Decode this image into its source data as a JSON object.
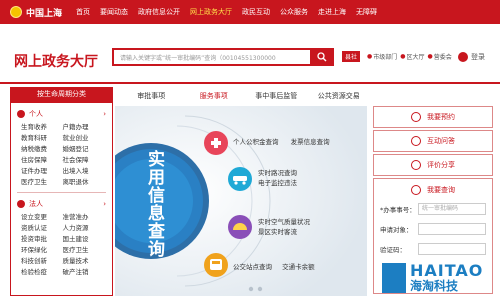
{
  "topnav": {
    "logo_text": "中国上海",
    "items": [
      {
        "label": "首页",
        "active": false
      },
      {
        "label": "要闻动态",
        "active": false
      },
      {
        "label": "政府信息公开",
        "active": false
      },
      {
        "label": "网上政务大厅",
        "active": true
      },
      {
        "label": "政民互动",
        "active": false
      },
      {
        "label": "公众服务",
        "active": false
      },
      {
        "label": "走进上海",
        "active": false
      },
      {
        "label": "无障碍",
        "active": false
      }
    ]
  },
  "header": {
    "site_title": "网上政务大厅",
    "search_placeholder": "请输入关键字或“统一审批编码”查询（00104551300000",
    "location_tag": "县社",
    "location_items": [
      "市级部门",
      "区大厅",
      "营委会"
    ],
    "user_label": "登录"
  },
  "tabs": [
    {
      "label": "审批事项",
      "active": false
    },
    {
      "label": "服务事项",
      "active": true
    },
    {
      "label": "事中事后监管",
      "active": false
    },
    {
      "label": "公共资源交易",
      "active": false
    }
  ],
  "left_panel": {
    "header": "按生命周期分类",
    "personal": {
      "title": "个人",
      "items": [
        "生育收养",
        "户籍办理",
        "教育科研",
        "就业创业",
        "纳税缴费",
        "婚姻登记",
        "住房保障",
        "社会保障",
        "证件办理",
        "出境入境",
        "医疗卫生",
        "离职退休"
      ]
    },
    "corporate": {
      "title": "法人",
      "items": [
        "设立变更",
        "准营准办",
        "资质认证",
        "人力资源",
        "投资审批",
        "国土建设",
        "环保绿化",
        "医疗卫生",
        "科技创新",
        "质量技术",
        "检验检疫",
        "破产注销"
      ]
    }
  },
  "banner": {
    "title": "实用信息查询",
    "items": [
      {
        "icon": "medical-icon",
        "text_lines": [
          "个人公积金查询",
          "发票信息查询"
        ],
        "color": "#e8455a"
      },
      {
        "icon": "car-icon",
        "text_lines": [
          "实时路况查询",
          "电子监控违法"
        ],
        "color": "#1fa9d6"
      },
      {
        "icon": "weather-icon",
        "text_lines": [
          "实时空气质量状况",
          "景区实时客流"
        ],
        "color": "#8a4fb8"
      },
      {
        "icon": "bus-icon",
        "text_lines": [
          "公交站点查询",
          "交通卡余额"
        ],
        "color": "#f0a21c"
      }
    ]
  },
  "right_panel": {
    "buttons": [
      {
        "label": "我要预约",
        "icon": "calendar-icon"
      },
      {
        "label": "互动问答",
        "icon": "chat-icon"
      },
      {
        "label": "评价分享",
        "icon": "star-icon"
      }
    ],
    "query": {
      "title": "我要查询",
      "fields": [
        {
          "label": "*办事事号：",
          "placeholder": "统一审批编码"
        },
        {
          "label": "申请对象：",
          "placeholder": ""
        },
        {
          "label": "验证码：",
          "placeholder": ""
        }
      ]
    }
  },
  "watermark": {
    "line1": "HAITAO",
    "line2": "海淘科技"
  },
  "colors": {
    "brand_red": "#c8161e",
    "active_nav": "#ffe14a",
    "watermark_blue": "#1c7ec2"
  }
}
